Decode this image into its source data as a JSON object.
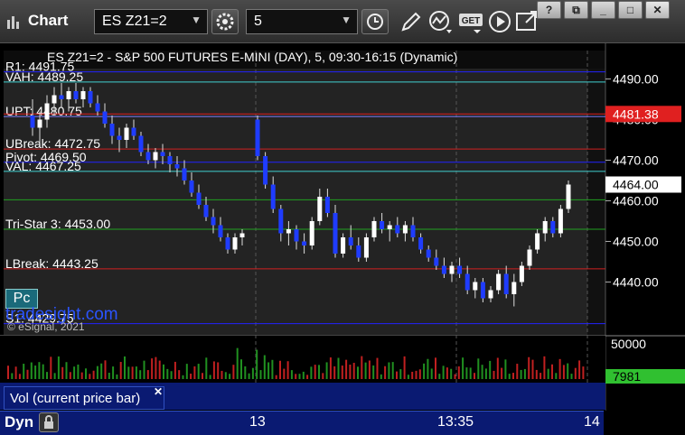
{
  "toolbar": {
    "title": "Chart",
    "symbol": "ES Z21=2",
    "interval": "5",
    "icons": [
      "settings-icon",
      "clock-icon",
      "pencil-icon",
      "indicator-icon",
      "get-icon",
      "play-icon",
      "open-window-icon"
    ],
    "window_buttons": [
      "?",
      "⧉",
      "_",
      "□",
      "✕"
    ]
  },
  "chart_title": "ES Z21=2 - S&P 500 FUTURES E-MINI (DAY), 5, 09:30-16:15 (Dynamic)",
  "levels": [
    {
      "label": "R1: 4491.75",
      "value": 4491.75,
      "color": "#2222ff"
    },
    {
      "label": "VAH: 4489.25",
      "value": 4489.25,
      "color": "#40d0d0"
    },
    {
      "label": "UPT: 4480.75",
      "value": 4480.75,
      "color": "#8080ff"
    },
    {
      "label": "UBreak: 4472.75",
      "value": 4472.75,
      "color": "#d02020"
    },
    {
      "label": "Pivot: 4469.50",
      "value": 4469.5,
      "color": "#2222ff"
    },
    {
      "label": "VAL: 4467.25",
      "value": 4467.25,
      "color": "#40d0d0"
    },
    {
      "label": "Tri-Star 3: 4453.00",
      "value": 4453.0,
      "color": "#20a020"
    },
    {
      "label": "LBreak: 4443.25",
      "value": 4443.25,
      "color": "#d02020"
    },
    {
      "label": "S1: 4429.75",
      "value": 4429.75,
      "color": "#2222ff"
    }
  ],
  "extra_lines": [
    {
      "value": 4481.38,
      "color": "#e02020"
    },
    {
      "value": 4460.25,
      "color": "#20a020"
    }
  ],
  "price_axis": {
    "ticks": [
      "4490.00",
      "4480.00",
      "4470.00",
      "4460.00",
      "4450.00",
      "4440.00"
    ],
    "last_price": "4481.38",
    "last_price_color": "#e02020",
    "current_price": "4464.00"
  },
  "volume_axis": {
    "tick": "50000",
    "current_volume": "7981"
  },
  "time_labels": [
    "13",
    "13:35",
    "14"
  ],
  "pc_button": "Pc",
  "watermark": "tradesight.com",
  "copyright": "© eSignal, 2021",
  "volume_label": "Vol (current price bar)",
  "dyn_label": "Dyn",
  "chart_data": {
    "type": "candlestick",
    "ylim": [
      4427,
      4497
    ],
    "candles": [
      [
        4481,
        4485,
        4476,
        4478
      ],
      [
        4478,
        4482,
        4474,
        4480
      ],
      [
        4480,
        4486,
        4478,
        4484
      ],
      [
        4484,
        4488,
        4481,
        4486
      ],
      [
        4486,
        4489,
        4483,
        4485
      ],
      [
        4485,
        4488,
        4482,
        4487
      ],
      [
        4487,
        4489,
        4484,
        4485
      ],
      [
        4485,
        4488,
        4483,
        4487
      ],
      [
        4487,
        4488,
        4483,
        4484
      ],
      [
        4484,
        4486,
        4481,
        4482
      ],
      [
        4482,
        4484,
        4478,
        4479
      ],
      [
        4479,
        4481,
        4474,
        4476
      ],
      [
        4476,
        4478,
        4472,
        4475
      ],
      [
        4475,
        4479,
        4473,
        4478
      ],
      [
        4478,
        4480,
        4475,
        4476
      ],
      [
        4476,
        4477,
        4471,
        4472
      ],
      [
        4472,
        4474,
        4469,
        4470
      ],
      [
        4470,
        4473,
        4468,
        4472
      ],
      [
        4472,
        4474,
        4469,
        4471
      ],
      [
        4471,
        4472,
        4467,
        4469
      ],
      [
        4469,
        4471,
        4466,
        4468
      ],
      [
        4468,
        4470,
        4464,
        4465
      ],
      [
        4465,
        4467,
        4461,
        4462
      ],
      [
        4462,
        4464,
        4458,
        4459
      ],
      [
        4459,
        4461,
        4455,
        4456
      ],
      [
        4456,
        4458,
        4452,
        4454
      ],
      [
        4454,
        4456,
        4450,
        4451
      ],
      [
        4451,
        4452,
        4447,
        4448
      ],
      [
        4448,
        4452,
        4447,
        4451
      ],
      [
        4451,
        4453,
        4449,
        4452
      ],
      [
        4480,
        4481,
        4470,
        4471
      ],
      [
        4471,
        4472,
        4463,
        4464
      ],
      [
        4464,
        4466,
        4457,
        4458
      ],
      [
        4458,
        4459,
        4450,
        4452
      ],
      [
        4452,
        4455,
        4449,
        4453
      ],
      [
        4453,
        4454,
        4448,
        4450
      ],
      [
        4450,
        4452,
        4447,
        4449
      ],
      [
        4449,
        4456,
        4448,
        4455
      ],
      [
        4455,
        4463,
        4454,
        4461
      ],
      [
        4461,
        4463,
        4456,
        4457
      ],
      [
        4457,
        4459,
        4446,
        4447
      ],
      [
        4447,
        4452,
        4446,
        4451
      ],
      [
        4451,
        4454,
        4448,
        4449
      ],
      [
        4449,
        4451,
        4445,
        4446
      ],
      [
        4446,
        4452,
        4445,
        4451
      ],
      [
        4451,
        4456,
        4450,
        4455
      ],
      [
        4455,
        4457,
        4452,
        4453
      ],
      [
        4453,
        4455,
        4450,
        4454
      ],
      [
        4454,
        4456,
        4451,
        4452
      ],
      [
        4452,
        4455,
        4450,
        4454
      ],
      [
        4454,
        4456,
        4450,
        4451
      ],
      [
        4451,
        4452,
        4447,
        4448
      ],
      [
        4448,
        4449,
        4445,
        4446
      ],
      [
        4446,
        4448,
        4443,
        4444
      ],
      [
        4444,
        4446,
        4441,
        4442
      ],
      [
        4442,
        4445,
        4440,
        4444
      ],
      [
        4444,
        4446,
        4441,
        4442
      ],
      [
        4442,
        4444,
        4437,
        4438
      ],
      [
        4438,
        4441,
        4436,
        4440
      ],
      [
        4440,
        4441,
        4435,
        4436
      ],
      [
        4436,
        4439,
        4435,
        4438
      ],
      [
        4438,
        4443,
        4437,
        4442
      ],
      [
        4442,
        4444,
        4436,
        4437
      ],
      [
        4437,
        4442,
        4434,
        4440
      ],
      [
        4440,
        4445,
        4439,
        4444
      ],
      [
        4444,
        4449,
        4443,
        4448
      ],
      [
        4448,
        4453,
        4447,
        4452
      ],
      [
        4452,
        4456,
        4450,
        4455
      ],
      [
        4455,
        4456,
        4451,
        4452
      ],
      [
        4452,
        4459,
        4451,
        4458
      ],
      [
        4458,
        4465,
        4457,
        4464
      ]
    ],
    "volume_max": 50000
  }
}
